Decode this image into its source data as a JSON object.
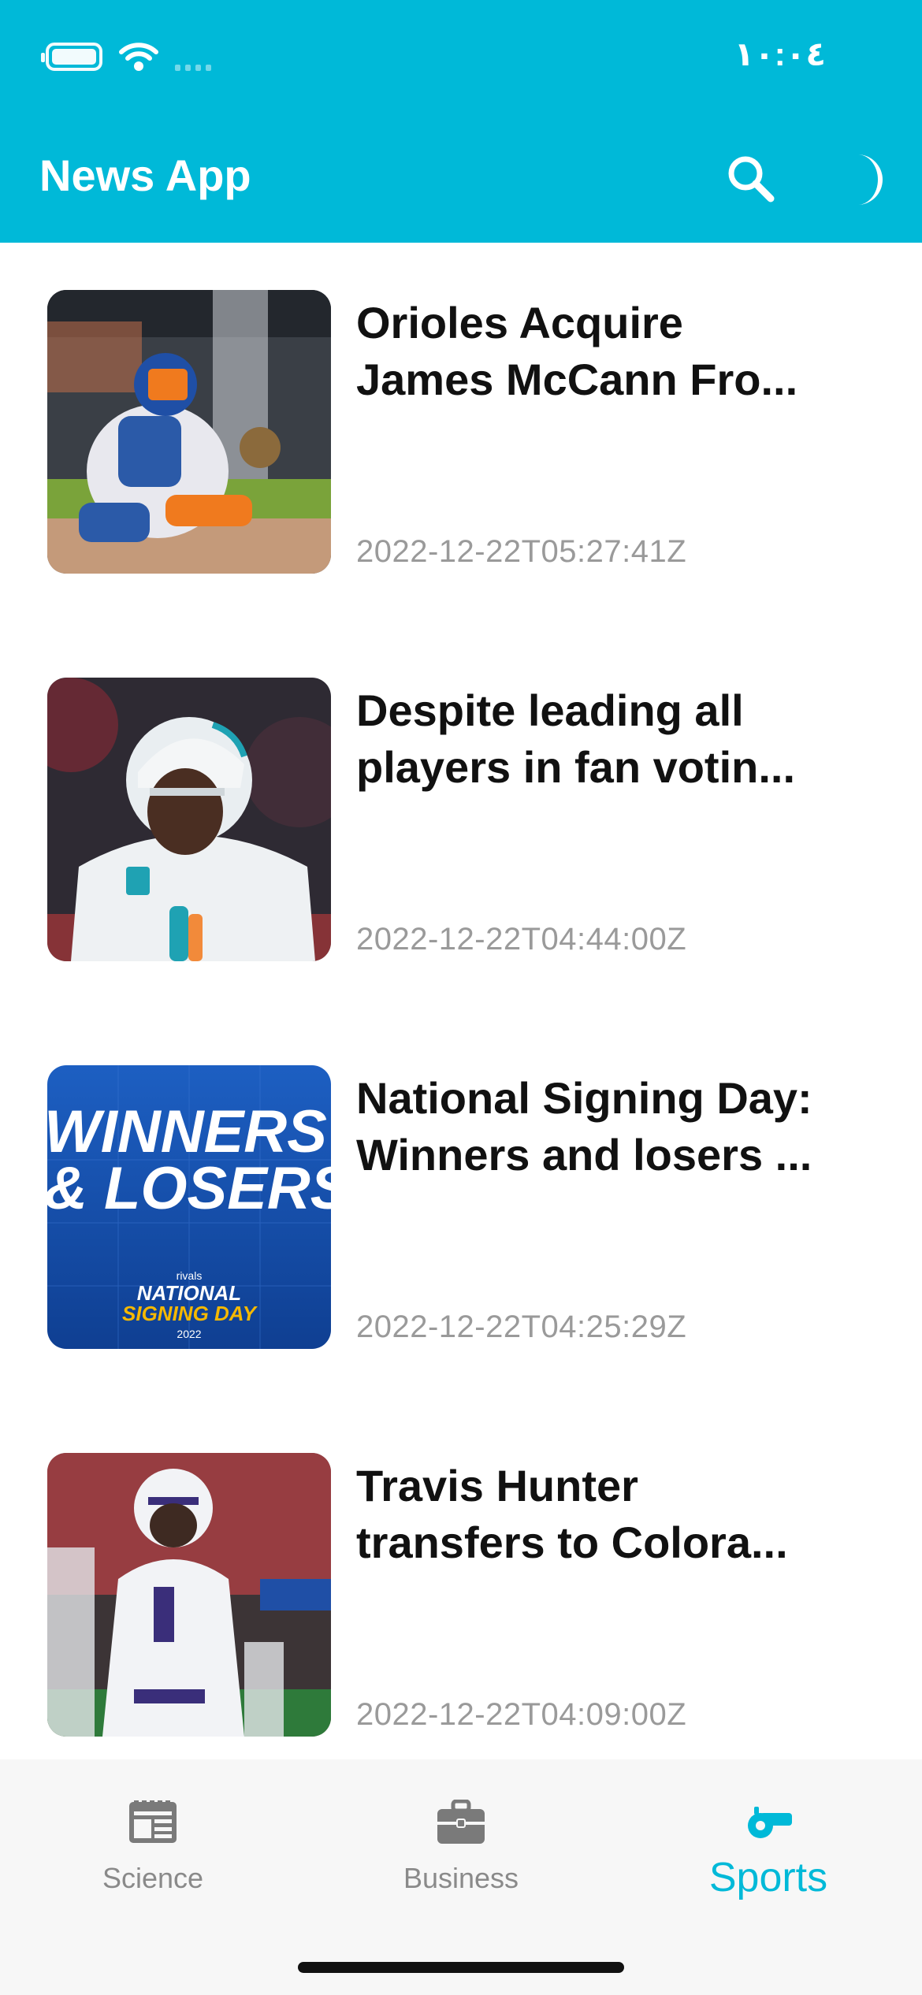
{
  "status_bar": {
    "time": "١٠:٠٤"
  },
  "app_bar": {
    "title": "News App",
    "search_icon": "search-icon",
    "theme_icon": "moon-icon"
  },
  "articles": [
    {
      "title": "Orioles Acquire James McCann Fro...",
      "title_line1": "Orioles Acquire",
      "title_line2": "James McCann Fro...",
      "date": "2022-12-22T05:27:41Z"
    },
    {
      "title": "Despite leading all players in fan votin...",
      "title_line1": "Despite leading all",
      "title_line2": "players in fan votin...",
      "date": "2022-12-22T04:44:00Z"
    },
    {
      "title": "National Signing Day: Winners and losers ...",
      "title_line1": "National Signing Day:",
      "title_line2": "Winners and losers ...",
      "date": "2022-12-22T04:25:29Z",
      "image_text": {
        "line1": "WINNERS",
        "line2": "& LOSERS",
        "brand": "rivals",
        "badge1": "NATIONAL",
        "badge2": "SIGNING DAY",
        "year": "2022"
      }
    },
    {
      "title": "Travis Hunter transfers to Colora...",
      "title_line1": "Travis Hunter",
      "title_line2": "transfers to Colora...",
      "date": "2022-12-22T04:09:00Z"
    }
  ],
  "bottom_nav": {
    "items": [
      {
        "label": "Science",
        "icon": "newspaper-icon"
      },
      {
        "label": "Business",
        "icon": "briefcase-icon"
      },
      {
        "label": "Sports",
        "icon": "whistle-icon",
        "active": true
      }
    ]
  },
  "colors": {
    "primary": "#00B9D8",
    "text": "#111111",
    "muted": "#9a9a9a",
    "nav_bg": "#f7f7f7"
  }
}
